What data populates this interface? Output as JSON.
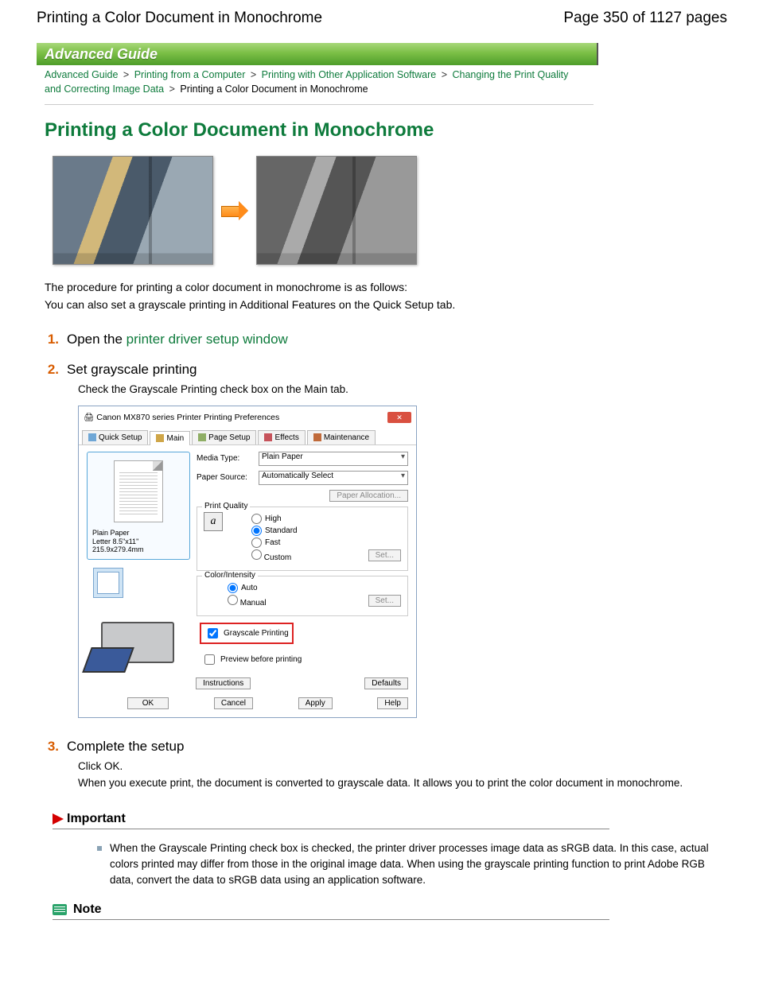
{
  "header": {
    "doc_title": "Printing a Color Document in Monochrome",
    "page_indicator": "Page 350 of 1127 pages"
  },
  "banner": "Advanced Guide",
  "breadcrumb": {
    "items": [
      {
        "label": "Advanced Guide",
        "link": true
      },
      {
        "label": "Printing from a Computer",
        "link": true
      },
      {
        "label": "Printing with Other Application Software",
        "link": true
      },
      {
        "label": "Changing the Print Quality and Correcting Image Data",
        "link": true
      },
      {
        "label": "Printing a Color Document in Monochrome",
        "link": false
      }
    ],
    "sep": ">"
  },
  "title": "Printing a Color Document in Monochrome",
  "intro": {
    "p1": "The procedure for printing a color document in monochrome is as follows:",
    "p2": "You can also set a grayscale printing in Additional Features on the Quick Setup tab."
  },
  "steps": {
    "s1": {
      "num": "1.",
      "text_a": "Open the ",
      "link": "printer driver setup window"
    },
    "s2": {
      "num": "2.",
      "head": "Set grayscale printing",
      "desc": "Check the Grayscale Printing check box on the Main tab."
    },
    "s3": {
      "num": "3.",
      "head": "Complete the setup",
      "d1": "Click OK.",
      "d2": "When you execute print, the document is converted to grayscale data. It allows you to print the color document in monochrome."
    }
  },
  "dialog": {
    "title": "Canon MX870 series Printer Printing Preferences",
    "tabs": [
      "Quick Setup",
      "Main",
      "Page Setup",
      "Effects",
      "Maintenance"
    ],
    "media_type_label": "Media Type:",
    "media_type_value": "Plain Paper",
    "paper_source_label": "Paper Source:",
    "paper_source_value": "Automatically Select",
    "paper_alloc_btn": "Paper Allocation...",
    "quality_legend": "Print Quality",
    "quality": {
      "high": "High",
      "standard": "Standard",
      "fast": "Fast",
      "custom": "Custom"
    },
    "set_btn": "Set...",
    "color_legend": "Color/Intensity",
    "color": {
      "auto": "Auto",
      "manual": "Manual"
    },
    "grayscale_cb": "Grayscale Printing",
    "preview_cb": "Preview before printing",
    "preview_caption1": "Plain Paper",
    "preview_caption2": "Letter 8.5\"x11\" 215.9x279.4mm",
    "btns": {
      "instructions": "Instructions",
      "defaults": "Defaults",
      "ok": "OK",
      "cancel": "Cancel",
      "apply": "Apply",
      "help": "Help"
    }
  },
  "important": {
    "head": "Important",
    "text": "When the Grayscale Printing check box is checked, the printer driver processes image data as sRGB data. In this case, actual colors printed may differ from those in the original image data. When using the grayscale printing function to print Adobe RGB data, convert the data to sRGB data using an application software."
  },
  "note": {
    "head": "Note"
  }
}
